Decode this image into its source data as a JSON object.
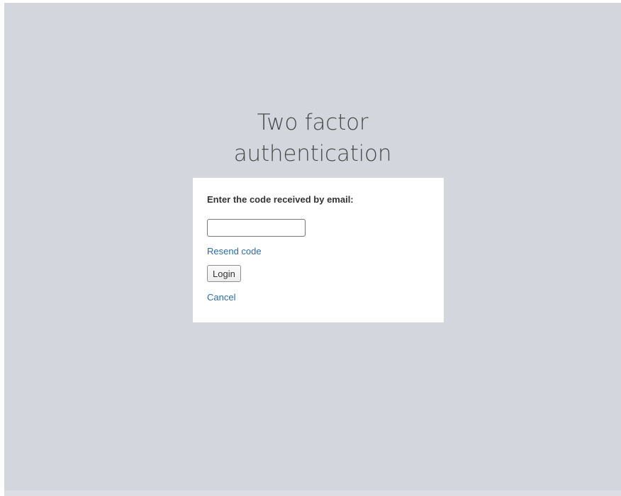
{
  "page": {
    "title_line1": "Two factor",
    "title_line2": "authentication"
  },
  "form": {
    "prompt": "Enter the code received by email:",
    "code_value": "",
    "resend_label": "Resend code",
    "login_label": "Login",
    "cancel_label": "Cancel"
  },
  "colors": {
    "background": "#d4d6de",
    "card": "#ffffff",
    "link": "#2e6da4",
    "title": "#4a4a4a"
  }
}
